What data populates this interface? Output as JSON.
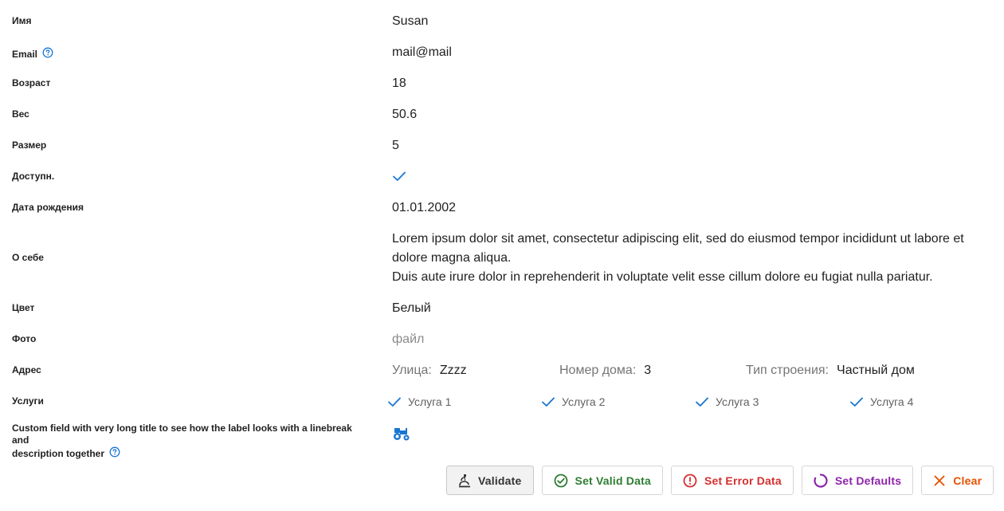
{
  "fields": {
    "name": {
      "label": "Имя",
      "value": "Susan"
    },
    "email": {
      "label": "Email",
      "value": "mail@mail"
    },
    "age": {
      "label": "Возраст",
      "value": "18"
    },
    "weight": {
      "label": "Вес",
      "value": "50.6"
    },
    "size": {
      "label": "Размер",
      "value": "5"
    },
    "available": {
      "label": "Доступн.",
      "value": true
    },
    "birthdate": {
      "label": "Дата рождения",
      "value": "01.01.2002"
    },
    "about": {
      "label": "О себе",
      "line1": "Lorem ipsum dolor sit amet, consectetur adipiscing elit, sed do eiusmod tempor incididunt ut labore et",
      "line2": "dolore magna aliqua.",
      "line3": "Duis aute irure dolor in reprehenderit in voluptate velit esse cillum dolore eu fugiat nulla pariatur."
    },
    "color": {
      "label": "Цвет",
      "value": "Белый"
    },
    "photo": {
      "label": "Фото",
      "placeholder": "файл"
    },
    "address": {
      "label": "Адрес",
      "street_label": "Улица:",
      "street_value": "Zzzz",
      "house_label": "Номер дома:",
      "house_value": "3",
      "type_label": "Тип строения:",
      "type_value": "Частный дом"
    },
    "services": {
      "label": "Услуги",
      "items": [
        "Услуга 1",
        "Услуга 2",
        "Услуга 3",
        "Услуга 4"
      ]
    },
    "custom": {
      "label_line1": "Custom field with very long title to see how the label looks with a linebreak and",
      "label_line2": "description together",
      "icon": "tractor-icon"
    }
  },
  "buttons": {
    "validate": "Validate",
    "set_valid": "Set Valid Data",
    "set_error": "Set Error Data",
    "set_defaults": "Set Defaults",
    "clear": "Clear"
  },
  "colors": {
    "accent_blue": "#1976d2",
    "valid_green": "#2e7d32",
    "error_red": "#d32f2f",
    "defaults_purple": "#8e24aa",
    "clear_orange": "#e65100"
  }
}
